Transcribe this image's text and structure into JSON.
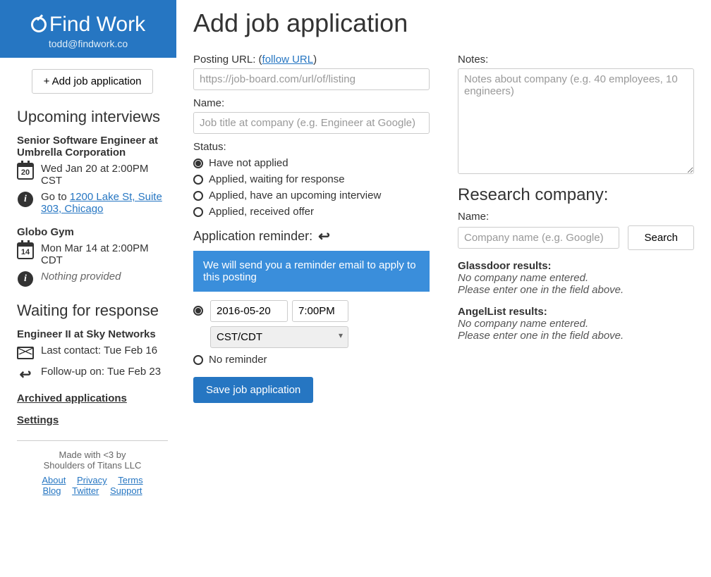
{
  "brand": {
    "name": "Find Work",
    "email": "todd@findwork.co"
  },
  "sidebar": {
    "add_button": "+ Add job application",
    "upcoming_h": "Upcoming interviews",
    "upcoming": [
      {
        "title": "Senior Software Engineer at Umbrella Corporation",
        "day": "20",
        "when": "Wed Jan 20 at 2:00PM CST",
        "goto_prefix": "Go to ",
        "goto_link": "1200 Lake St, Suite 303, Chicago"
      },
      {
        "title": "Globo Gym",
        "day": "14",
        "when": "Mon Mar 14 at 2:00PM CDT",
        "nothing": "Nothing provided"
      }
    ],
    "waiting_h": "Waiting for response",
    "waiting": [
      {
        "title": "Engineer II at Sky Networks",
        "last_contact": "Last contact: Tue Feb 16",
        "followup": "Follow-up on: Tue Feb 23"
      }
    ],
    "archived": "Archived applications",
    "settings": "Settings",
    "footer1": "Made with <3 by",
    "footer2": "Shoulders of Titans LLC",
    "links": [
      "About",
      "Privacy",
      "Terms",
      "Blog",
      "Twitter",
      "Support"
    ]
  },
  "main": {
    "title": "Add job application",
    "posting_url_label": "Posting URL: (",
    "follow_url": "follow URL",
    "posting_url_close": ")",
    "posting_url_ph": "https://job-board.com/url/of/listing",
    "name_label": "Name:",
    "name_ph": "Job title at company (e.g. Engineer at Google)",
    "status_label": "Status:",
    "status_opts": [
      "Have not applied",
      "Applied, waiting for response",
      "Applied, have an upcoming interview",
      "Applied, received offer"
    ],
    "reminder_h": "Application reminder:",
    "notice": "We will send you a reminder email to apply to this posting",
    "reminder_date": "2016-05-20",
    "reminder_time": "7:00PM",
    "reminder_tz": "CST/CDT",
    "no_reminder": "No reminder",
    "save": "Save job application",
    "notes_label": "Notes:",
    "notes_ph": "Notes about company (e.g. 40 employees, 10 engineers)",
    "research_h": "Research company:",
    "company_label": "Name:",
    "company_ph": "Company name (e.g. Google)",
    "search": "Search",
    "glassdoor_h": "Glassdoor results:",
    "angel_h": "AngelList results:",
    "no_company_1": "No company name entered.",
    "no_company_2": "Please enter one in the field above."
  }
}
